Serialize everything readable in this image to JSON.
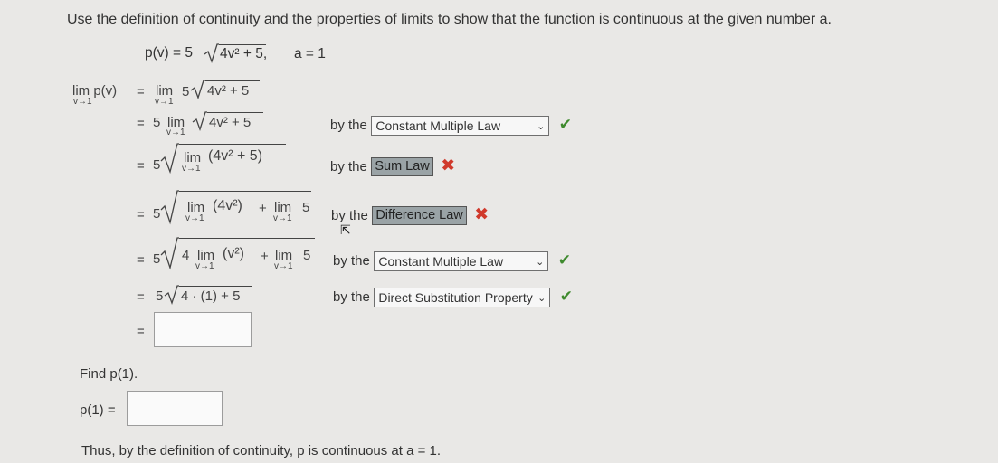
{
  "instruction": "Use the definition of continuity and the properties of limits to show that the function is continuous at the given number a.",
  "function": {
    "lhs": "p(v) = 5",
    "radicand": "4v² + 5,",
    "a_text": "a = 1"
  },
  "lim_label": "lim",
  "lim_sub": "v→1",
  "steps": [
    {
      "lhs": "lim p(v)",
      "eq": "=",
      "expr": "lim 5√(4v² + 5)"
    },
    {
      "eq": "=",
      "expr": "5 lim √(4v² + 5)",
      "by": "by the",
      "law": "Constant Multiple Law",
      "law_type": "dropdown",
      "status": "correct"
    },
    {
      "eq": "=",
      "expr": "5√(lim (4v² + 5))",
      "by": "by the",
      "law": "Sum Law",
      "law_type": "selected",
      "status": "incorrect"
    },
    {
      "eq": "=",
      "expr": "5√(lim (4v²) + lim 5)",
      "by": "by the",
      "law": "Difference Law",
      "law_type": "selected",
      "status": "incorrect"
    },
    {
      "eq": "=",
      "expr": "5√(4 lim (v²) + lim 5)",
      "by": "by the",
      "law": "Constant Multiple Law",
      "law_type": "dropdown",
      "status": "correct"
    },
    {
      "eq": "=",
      "expr": "5√(4 · (1) + 5)",
      "by": "by the",
      "law": "Direct Substitution Property",
      "law_type": "dropdown",
      "status": "correct"
    },
    {
      "eq": "=",
      "answer": ""
    }
  ],
  "math_text": {
    "five": "5",
    "radicand1": "4v² + 5",
    "lim_expr": "(4v² + 5)",
    "term_4v2": "(4v²)",
    "plus": "+",
    "lim5": "5",
    "four": "4",
    "v2": "(v²)",
    "sub_expr": "4 · (1) + 5"
  },
  "find": {
    "prompt": "Find p(1).",
    "label": "p(1) =",
    "answer": ""
  },
  "conclusion": "Thus, by the definition of continuity, p is continuous at a = 1.",
  "colors": {
    "check": "#3f8a2e",
    "cross": "#d0392b",
    "selected_bg": "#9aa3a6"
  },
  "icons": {
    "correct": "check-icon",
    "incorrect": "cross-icon",
    "dropdown": "chevron-down-icon"
  },
  "glyphs": {
    "check": "✔",
    "cross": "✖",
    "chevron": "⌄",
    "cursor": "⇱"
  }
}
